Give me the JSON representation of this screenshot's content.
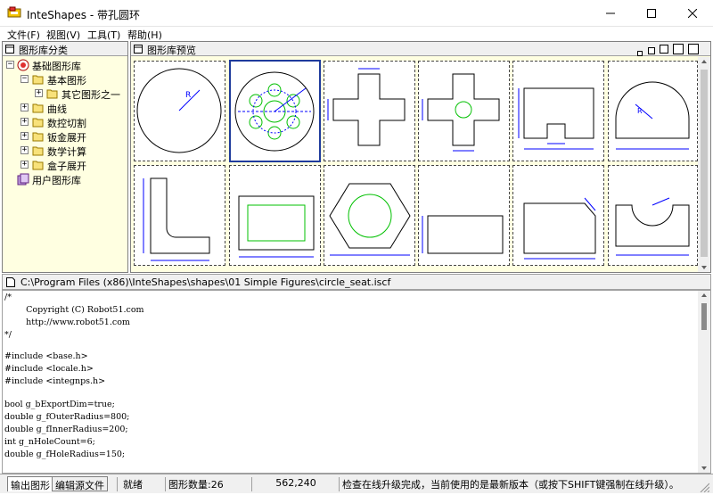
{
  "window": {
    "title": "InteShapes - 带孔圆环",
    "minimize_icon": "minimize-icon",
    "maximize_icon": "maximize-icon",
    "close_icon": "close-icon"
  },
  "menu": {
    "items": [
      "文件(F)",
      "视图(V)",
      "工具(T)",
      "帮助(H)"
    ]
  },
  "tree_panel": {
    "title": "图形库分类",
    "root": "基础图形库",
    "items": [
      {
        "label": "基本图形"
      },
      {
        "label": "其它图形之一"
      },
      {
        "label": "曲线"
      },
      {
        "label": "数控切割"
      },
      {
        "label": "钣金展开"
      },
      {
        "label": "数学计算"
      },
      {
        "label": "盒子展开"
      }
    ],
    "user_lib": "用户图形库"
  },
  "preview_panel": {
    "title": "图形库预览"
  },
  "path_bar": {
    "path": "C:\\Program Files (x86)\\InteShapes\\shapes\\01 Simple Figures\\circle_seat.iscf"
  },
  "code": {
    "lines": [
      "/*",
      "        Copyright (C) Robot51.com",
      "        http://www.robot51.com",
      "*/",
      "",
      "#include <base.h>",
      "#include <locale.h>",
      "#include <integnps.h>",
      "",
      "bool g_bExportDim=true;",
      "double g_fOuterRadius=800;",
      "double g_fInnerRadius=200;",
      "int g_nHoleCount=6;",
      "double g_fHoleRadius=150;"
    ]
  },
  "status": {
    "tabs": [
      "输出图形",
      "编辑源文件"
    ],
    "ready": "就绪",
    "shape_count": "图形数量:26",
    "coords": "562,240",
    "message": "检查在线升级完成，当前使用的是最新版本（或按下SHIFT键强制在线升级）。"
  },
  "colors": {
    "panel_bg": "#ffffe1",
    "selected_border": "#1f3b9c",
    "dim_blue": "#0000ff",
    "shape_green": "#00c000"
  }
}
